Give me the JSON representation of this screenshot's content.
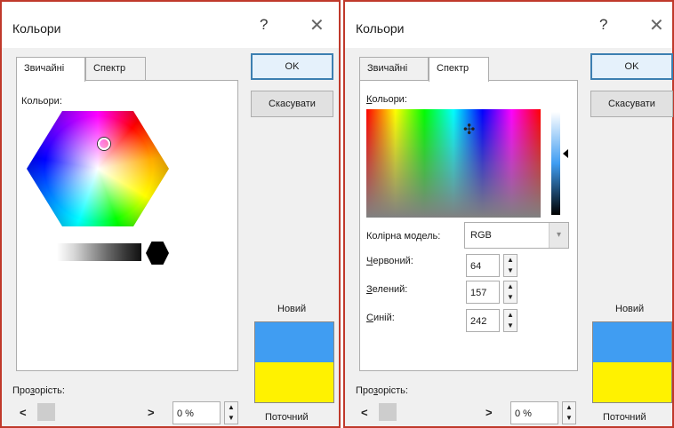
{
  "dialog1": {
    "title": "Кольори",
    "help": "?",
    "close": "✕",
    "tabs": [
      "Звичайні",
      "Спектр"
    ],
    "colors_label": "Кольори:",
    "ok": "OK",
    "cancel": "Скасувати",
    "new_label": "Новий",
    "current_label": "Поточний",
    "transparency_label": "Прозорість:",
    "transparency_value": "0 %",
    "scroll_left": "<",
    "scroll_right": ">",
    "new_color": "#409df2",
    "current_color": "#fff200"
  },
  "dialog2": {
    "title": "Кольори",
    "help": "?",
    "close": "✕",
    "tabs": [
      "Звичайні",
      "Спектр"
    ],
    "colors_label": "Кольори:",
    "ok": "OK",
    "cancel": "Скасувати",
    "model_label": "Колірна модель:",
    "model_value": "RGB",
    "red_label": "Червоний:",
    "red_value": "64",
    "green_label": "Зелений:",
    "green_value": "157",
    "blue_label": "Синій:",
    "blue_value": "242",
    "new_label": "Новий",
    "current_label": "Поточний",
    "transparency_label": "Прозорість:",
    "transparency_value": "0 %",
    "scroll_left": "<",
    "scroll_right": ">",
    "new_color": "#409df2",
    "current_color": "#fff200"
  },
  "icons": {
    "spin_up": "▲",
    "spin_down": "▼",
    "combo_arrow": "▾",
    "crosshair": "✣"
  }
}
